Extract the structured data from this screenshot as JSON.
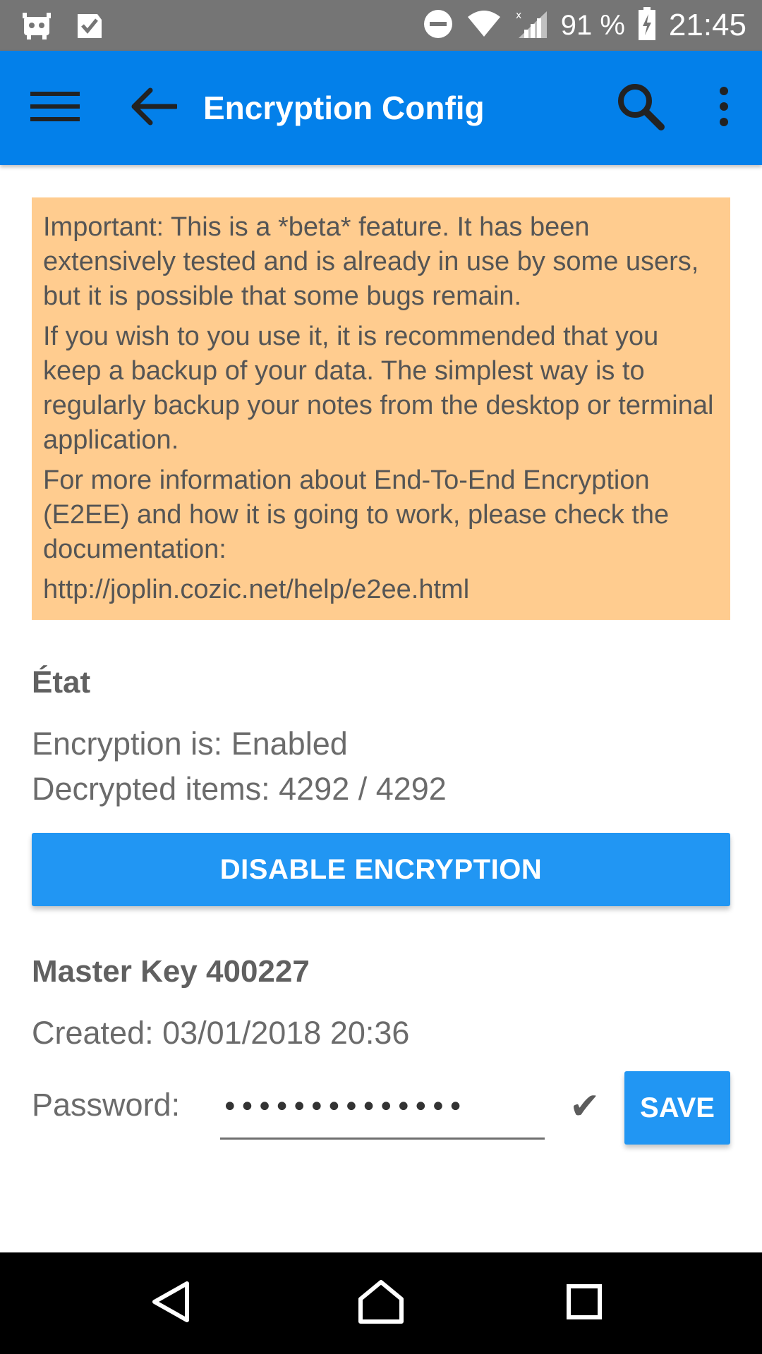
{
  "status_bar": {
    "battery_percent": "91 %",
    "time": "21:45",
    "icons": [
      "app-notification-icon",
      "check-notification-icon",
      "do-not-disturb-icon",
      "wifi-icon",
      "cell-signal-icon",
      "battery-charging-icon"
    ]
  },
  "app_bar": {
    "title": "Encryption Config",
    "icons": [
      "menu-icon",
      "back-arrow-icon",
      "search-icon",
      "more-vert-icon"
    ],
    "color": "#0380EA"
  },
  "warning": {
    "paragraphs": [
      "Important: This is a *beta* feature. It has been extensively tested and is already in use by some users, but it is possible that some bugs remain.",
      "If you wish to you use it, it is recommended that you keep a backup of your data. The simplest way is to regularly backup your notes from the desktop or terminal application.",
      "For more information about End-To-End Encryption (E2EE) and how it is going to work, please check the documentation:",
      "http://joplin.cozic.net/help/e2ee.html"
    ],
    "background": "#FFCC8F"
  },
  "status_section": {
    "title": "État",
    "encryption_status": "Encryption is: Enabled",
    "decrypted_items": "Decrypted items: 4292 / 4292"
  },
  "disable_button": {
    "label": "DISABLE ENCRYPTION",
    "color": "#2196F3"
  },
  "master_key": {
    "title": "Master Key 400227",
    "created": "Created: 03/01/2018 20:36",
    "password_label": "Password:",
    "password_value": "••••••••••••••",
    "check_icon": "check-icon",
    "save_label": "SAVE"
  },
  "nav_bar": {
    "icons": [
      "back-triangle-icon",
      "home-icon",
      "recents-icon"
    ]
  }
}
